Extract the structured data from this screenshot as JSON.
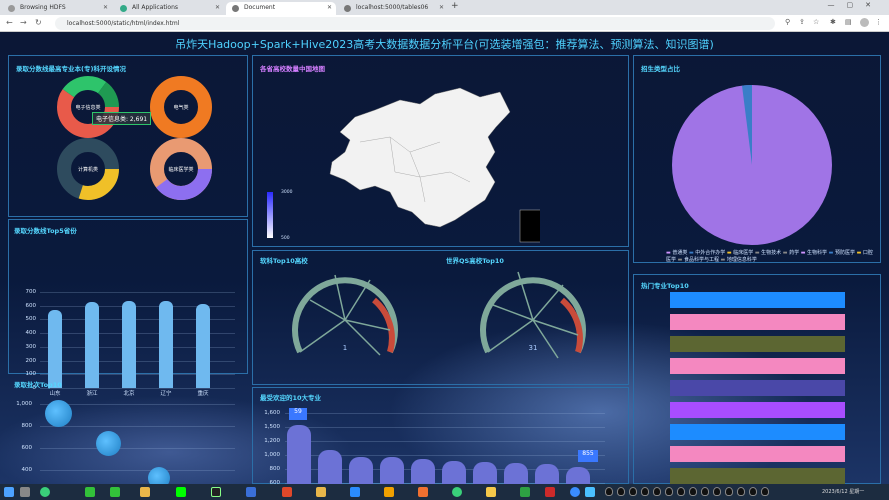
{
  "tabs": [
    {
      "label": "Browsing HDFS"
    },
    {
      "label": "All Applications"
    },
    {
      "label": "Document"
    },
    {
      "label": "localhost:5000/tables06"
    }
  ],
  "address": {
    "url": "localhost:5000/static/html/index.html"
  },
  "dashboard": {
    "title": "吊炸天Hadoop+Spark+Hive2023高考大数据数据分析平台(可选装增强包：推荐算法、预测算法、知识图谱)",
    "panels": {
      "donut": {
        "title": "录取分数线最高专业本(专)科开设情况",
        "tooltip": "电子信息类: 2,691",
        "labels": [
          "电子信息类",
          "电气类",
          "计算机类",
          "临床医学类"
        ]
      },
      "map": {
        "title": "各省高校数量中国地图",
        "legend_max": "3000",
        "legend_min": "500"
      },
      "pie": {
        "title": "招生类型占比",
        "legend": [
          "普通类",
          "中外合作办学",
          "临床医学",
          "生物技术",
          "药学",
          "生物科学",
          "预防医学",
          "口腔医学",
          "食品科学与工程",
          "地理信息科学"
        ]
      },
      "top5": {
        "title": "录取分数线Top5省份"
      },
      "soft": {
        "title": "软科Top10高校",
        "value": "1"
      },
      "qs": {
        "title": "世界QS高校Top10",
        "value": "31"
      },
      "batch": {
        "title": "录取批次Top10"
      },
      "popular": {
        "title": "最受欢迎的10大专业",
        "top_label": "59",
        "end_label": "855"
      },
      "hot": {
        "title": "热门专业Top10"
      }
    }
  },
  "chart_data": [
    {
      "type": "bar",
      "title": "录取分数线Top5省份",
      "categories": [
        "山东",
        "浙江",
        "北京",
        "辽宁",
        "重庆"
      ],
      "values": [
        570,
        630,
        635,
        635,
        610
      ],
      "ylim": [
        0,
        700
      ],
      "yticks": [
        "700",
        "600",
        "500",
        "400",
        "300",
        "200",
        "100",
        "0"
      ]
    },
    {
      "type": "scatter",
      "title": "录取批次Top10",
      "yticks": [
        "1,000",
        "800",
        "600",
        "400"
      ]
    },
    {
      "type": "bar",
      "title": "最受欢迎的10大专业",
      "yticks": [
        "1,600",
        "1,500",
        "1,200",
        "1,000",
        "800",
        "600"
      ]
    },
    {
      "type": "pie",
      "title": "招生类型占比",
      "values": [
        97,
        1.5,
        1.5
      ],
      "colors": [
        "#a074e6",
        "#3a7ec8",
        "#4aa0d0"
      ]
    },
    {
      "type": "donut",
      "values": [
        [
          60,
          25,
          15
        ],
        [
          100
        ],
        [
          30,
          70
        ],
        [
          40,
          60
        ]
      ]
    }
  ],
  "taskbar": {
    "clock": "2023/6/12 星期一"
  },
  "colors": {
    "accent": "#55d7ff",
    "panel_border": "#2b6fa8",
    "bar": "#6fb9ef"
  }
}
